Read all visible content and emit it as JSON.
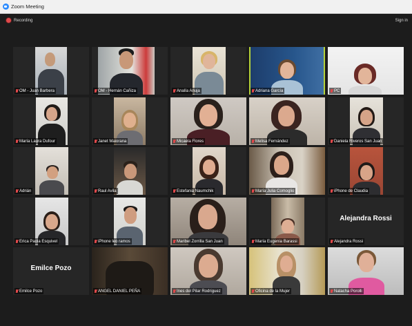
{
  "window": {
    "title": "Zoom Meeting",
    "app_icon": "zoom-icon"
  },
  "topbar": {
    "recording_label": "Recording",
    "sign_in_label": "Sign in"
  },
  "colors": {
    "active_speaker": "#b6d33a",
    "muted_mic": "#e0494b",
    "background": "#1c1c1c"
  },
  "participants": [
    {
      "name": "OM - Juan Barbera",
      "muted": true
    },
    {
      "name": "OM - Hernán Cañiza",
      "muted": true
    },
    {
      "name": "Analía Anuja",
      "muted": true
    },
    {
      "name": "Adriana García",
      "muted": true,
      "active": true
    },
    {
      "name": "PC",
      "muted": true
    },
    {
      "name": "María Laura Dufour",
      "muted": true
    },
    {
      "name": "Janet Maiorana",
      "muted": true
    },
    {
      "name": "Micaela Flores",
      "muted": true
    },
    {
      "name": "Melisa Fernández",
      "muted": true
    },
    {
      "name": "Daniela Riveros San Juan",
      "muted": true
    },
    {
      "name": "Adrián",
      "muted": true
    },
    {
      "name": "Raul Avila",
      "muted": true
    },
    {
      "name": "Estefania Naumchik",
      "muted": true
    },
    {
      "name": "María Julia Comoglio",
      "muted": true
    },
    {
      "name": "iPhone de Claudia",
      "muted": true
    },
    {
      "name": "Erica Paola Esquivel",
      "muted": true
    },
    {
      "name": "iPhone leo ramos",
      "muted": true
    },
    {
      "name": "Maribel Zorrilla San Juan",
      "muted": true
    },
    {
      "name": "María Eugenia Barassi",
      "muted": true
    },
    {
      "name": "Alejandra Rossi",
      "muted": true,
      "video_off": true,
      "display_name": "Alejandra Rossi"
    },
    {
      "name": "Emilce Pozo",
      "muted": true,
      "video_off": true,
      "display_name": "Emilce Pozo"
    },
    {
      "name": "ANGEL DANIEL PEÑA",
      "muted": true
    },
    {
      "name": "Ines del Pilar Rodriguez",
      "muted": true
    },
    {
      "name": "Oficina de la Mujer",
      "muted": true
    },
    {
      "name": "Natacha Porolli",
      "muted": true
    }
  ]
}
